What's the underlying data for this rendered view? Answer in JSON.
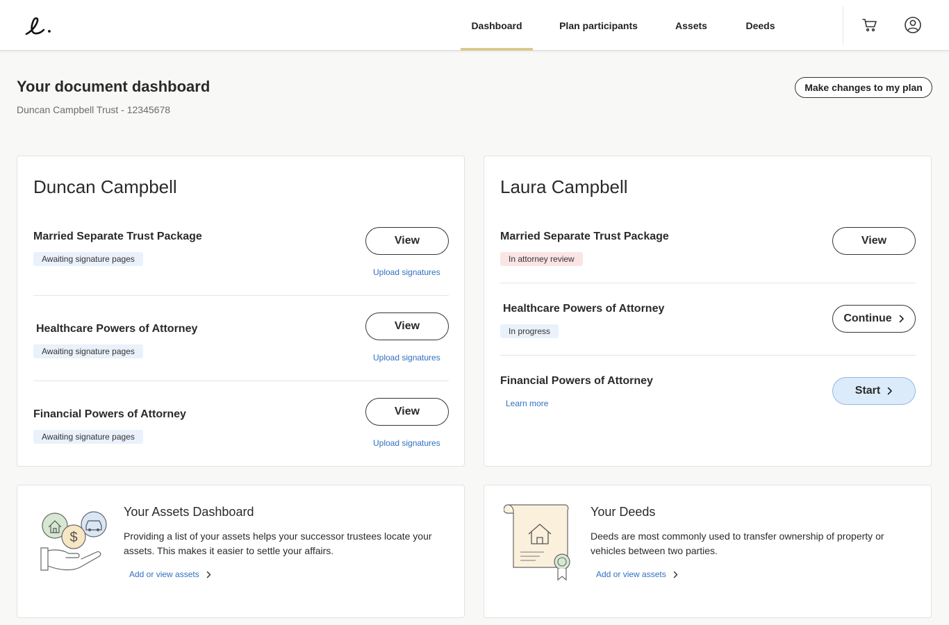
{
  "nav": {
    "logo": "e.",
    "items": [
      {
        "label": "Dashboard",
        "active": true
      },
      {
        "label": "Plan participants",
        "active": false
      },
      {
        "label": "Assets",
        "active": false
      },
      {
        "label": "Deeds",
        "active": false
      }
    ],
    "cart_icon": "cart-icon",
    "account_icon": "user-account-icon"
  },
  "header": {
    "title": "Your document dashboard",
    "subtitle": "Duncan Campbell Trust - 12345678",
    "make_changes_label": "Make changes to my plan"
  },
  "left_person": {
    "name": "Duncan Campbell",
    "docs": [
      {
        "title": "Married Separate Trust Package",
        "status": "Awaiting signature pages",
        "button": "View",
        "link": "Upload signatures"
      },
      {
        "title": "Healthcare Powers of Attorney",
        "status": "Awaiting signature pages",
        "button": "View",
        "link": "Upload signatures"
      },
      {
        "title": "Financial Powers of Attorney",
        "status": "Awaiting signature pages",
        "button": "View",
        "link": "Upload signatures"
      }
    ]
  },
  "right_person": {
    "name": "Laura Campbell",
    "docs": [
      {
        "title": "Married Separate Trust Package",
        "status": "In attorney review",
        "button": "View"
      },
      {
        "title": "Healthcare Powers of Attorney",
        "status": "In progress",
        "button": "Continue"
      },
      {
        "title": "Financial Powers of Attorney",
        "link": "Learn more",
        "button": "Start"
      }
    ]
  },
  "assets_card": {
    "title": "Your Assets Dashboard",
    "text": "Providing a list of your assets helps your successor trustees locate your assets. This makes it easier to settle your affairs.",
    "link": "Add or view assets",
    "illustration": "assets-hand-illustration"
  },
  "deeds_card": {
    "title": "Your Deeds",
    "text": "Deeds are most commonly used to transfer ownership of property or vehicles between two parties.",
    "link": "Add or view assets",
    "illustration": "deed-document-illustration"
  },
  "colors": {
    "active_tab_underline": "#d9c98c",
    "link": "#2f6fbf",
    "badge_blue": "#eaf1fb",
    "badge_pink": "#fbe4e4",
    "start_button": "#dcebfa"
  }
}
